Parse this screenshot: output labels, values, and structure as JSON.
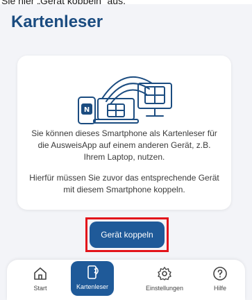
{
  "caption": "Sie hier „Gerät koppeln“ aus.",
  "header": {
    "title": "Kartenleser"
  },
  "card": {
    "paragraph_1": "Sie können dieses Smartphone als Kartenleser für die AusweisApp auf einem anderen Gerät, z.B. Ihrem Laptop, nutzen.",
    "paragraph_2": "Hierfür müssen Sie zuvor das entsprechende Gerät mit diesem Smartphone koppeln.",
    "illustration_icon": "devices-nfc-illustration"
  },
  "actions": {
    "pair_label": "Gerät koppeln"
  },
  "colors": {
    "primary": "#1f5a99",
    "title": "#1b4c80",
    "highlight": "#e3141b",
    "background": "#f3f4f8"
  },
  "nav": {
    "items": [
      {
        "label": "Start",
        "icon": "home-icon",
        "active": false
      },
      {
        "label": "Kartenleser",
        "icon": "card-reader-icon",
        "active": true
      },
      {
        "label": "Einstellungen",
        "icon": "gear-icon",
        "active": false
      },
      {
        "label": "Hilfe",
        "icon": "help-icon",
        "active": false
      }
    ]
  }
}
